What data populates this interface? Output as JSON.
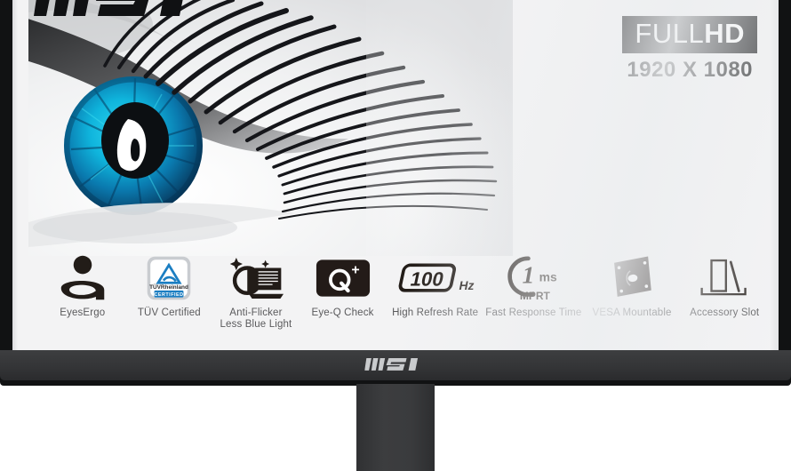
{
  "product": {
    "brand": "MSI",
    "brand_logo_bezel": "MSI",
    "panel_background_color": "#f3f3f4",
    "bezel_color": "#111213",
    "stand_color": "#3a3b3d"
  },
  "badge": {
    "full_label": "FULL",
    "hd_label": "HD",
    "resolution": "1920 X 1080",
    "badge_bg": "#111214",
    "badge_fg": "#ffffff"
  },
  "artwork": {
    "name": "close-up-blue-eye-with-eyelashes",
    "iris_color_light": "#19c6e4",
    "iris_color_mid": "#0d8fbe",
    "iris_color_dark": "#0a3f63",
    "pupil_color": "#101215",
    "highlight_color": "#ffffff"
  },
  "features": [
    {
      "id": "eyes-ergo",
      "icon": "eyes-ergo-icon",
      "label": "EyesErgo"
    },
    {
      "id": "tuv-certified",
      "icon": "tuv-rheinland-badge-icon",
      "label": "TÜV Certified",
      "badge_line1": "TÜVRheinland",
      "badge_line2": "CERTIFIED",
      "badge_color": "#1b7ec2"
    },
    {
      "id": "anti-flicker",
      "icon": "anti-flicker-less-blue-light-icon",
      "label": "Anti-Flicker\nLess Blue Light",
      "label_line1": "Anti-Flicker",
      "label_line2": "Less Blue Light"
    },
    {
      "id": "eye-q-check",
      "icon": "eye-q-check-icon",
      "label": "Eye-Q Check",
      "icon_text": "Q",
      "icon_superscript": "+"
    },
    {
      "id": "high-refresh-rate",
      "icon": "refresh-rate-100hz-icon",
      "label": "High Refresh Rate",
      "value": "100",
      "unit": "Hz"
    },
    {
      "id": "fast-response-time",
      "icon": "response-time-1ms-icon",
      "label": "Fast Response Time",
      "value": "1",
      "unit": "ms",
      "sub": "MPRT"
    },
    {
      "id": "vesa-mountable",
      "icon": "vesa-mount-plate-icon",
      "label": "VESA Mountable"
    },
    {
      "id": "accessory-slot",
      "icon": "accessory-slot-icon",
      "label": "Accessory Slot"
    }
  ]
}
